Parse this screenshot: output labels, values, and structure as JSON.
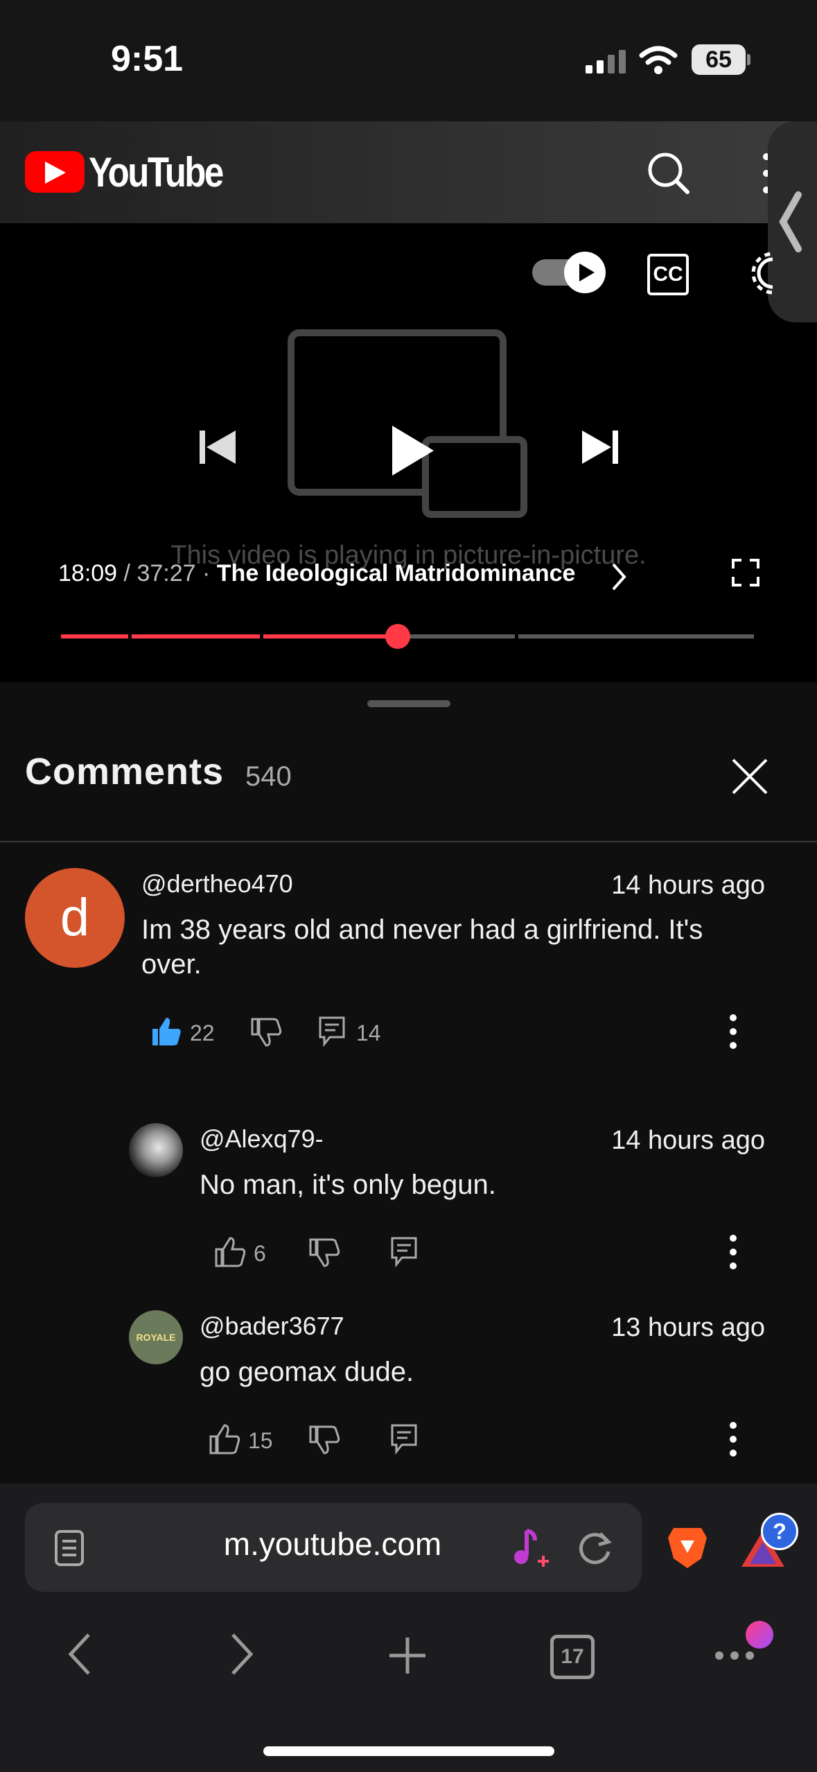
{
  "status_bar": {
    "time": "9:51",
    "battery": "65"
  },
  "header": {
    "brand": "YouTube"
  },
  "player": {
    "pip_message": "This video is playing in picture-in-picture.",
    "current_time": "18:09",
    "separator": "/",
    "duration": "37:27",
    "dot": "·",
    "chapter_title": "The Ideological Matridominance",
    "cc_label": "CC",
    "progress_fraction": 0.48
  },
  "comments": {
    "title": "Comments",
    "count": "540",
    "items": [
      {
        "avatar_letter": "d",
        "handle": "@dertheo470",
        "time": "14 hours ago",
        "text_line1": "Im 38 years old and never had a girlfriend. It's",
        "text_line2": "over.",
        "likes": "22",
        "replies": "14",
        "avatar_color": "#d4552c"
      },
      {
        "handle": "@Alexq79-",
        "time": "14 hours ago",
        "text_line1": "No man, it's only begun.",
        "likes": "6"
      },
      {
        "handle": "@bader3677",
        "time": "13 hours ago",
        "text_line1": "go geomax dude.",
        "likes": "15",
        "avatar_text": "ROYALE"
      }
    ]
  },
  "browser": {
    "url": "m.youtube.com",
    "tab_count": "17"
  },
  "colors": {
    "accent": "#ff3a46",
    "like_blue": "#3ea6ff",
    "brand_red": "#ff0000"
  }
}
